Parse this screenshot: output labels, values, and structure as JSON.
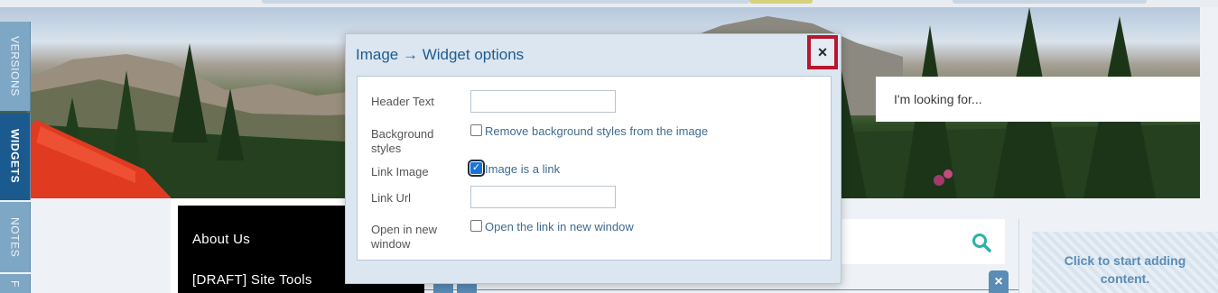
{
  "side_tabs": [
    {
      "label": "VERSIONS",
      "active": false
    },
    {
      "label": "WIDGETS",
      "active": true
    },
    {
      "label": "NOTES",
      "active": false
    },
    {
      "label": "F",
      "active": false
    }
  ],
  "search_placeholder": "I'm looking for...",
  "nav": {
    "items": [
      "About Us",
      "[DRAFT] Site Tools"
    ]
  },
  "drop_zone": {
    "line1": "Click to start adding",
    "line2": "content."
  },
  "widget_close_glyph": "×",
  "dialog": {
    "title": "Image → Widget options",
    "close_glyph": "×",
    "fields": {
      "header_text": {
        "label": "Header Text",
        "value": ""
      },
      "background_styles": {
        "label_line1": "Background",
        "label_line2": "styles",
        "checkbox_label": "Remove background styles from the image",
        "checked": false
      },
      "link_image": {
        "label": "Link Image",
        "checkbox_label": "Image is a link",
        "checked": true
      },
      "link_url": {
        "label": "Link Url",
        "value": ""
      },
      "open_new_window": {
        "label_line1": "Open in new",
        "label_line2": "window",
        "checkbox_label": "Open the link in new window",
        "checked": false
      }
    }
  },
  "icons": {
    "search": "magnifier-icon",
    "close": "close-icon"
  },
  "colors": {
    "accent": "#1a5a8f",
    "tab_inactive": "#7ea7c6",
    "dialog_title": "#1e5c8f",
    "close_highlight": "#b8172f",
    "search_icon": "#2bb3a3",
    "drop_zone_text": "#5a8cb5"
  }
}
